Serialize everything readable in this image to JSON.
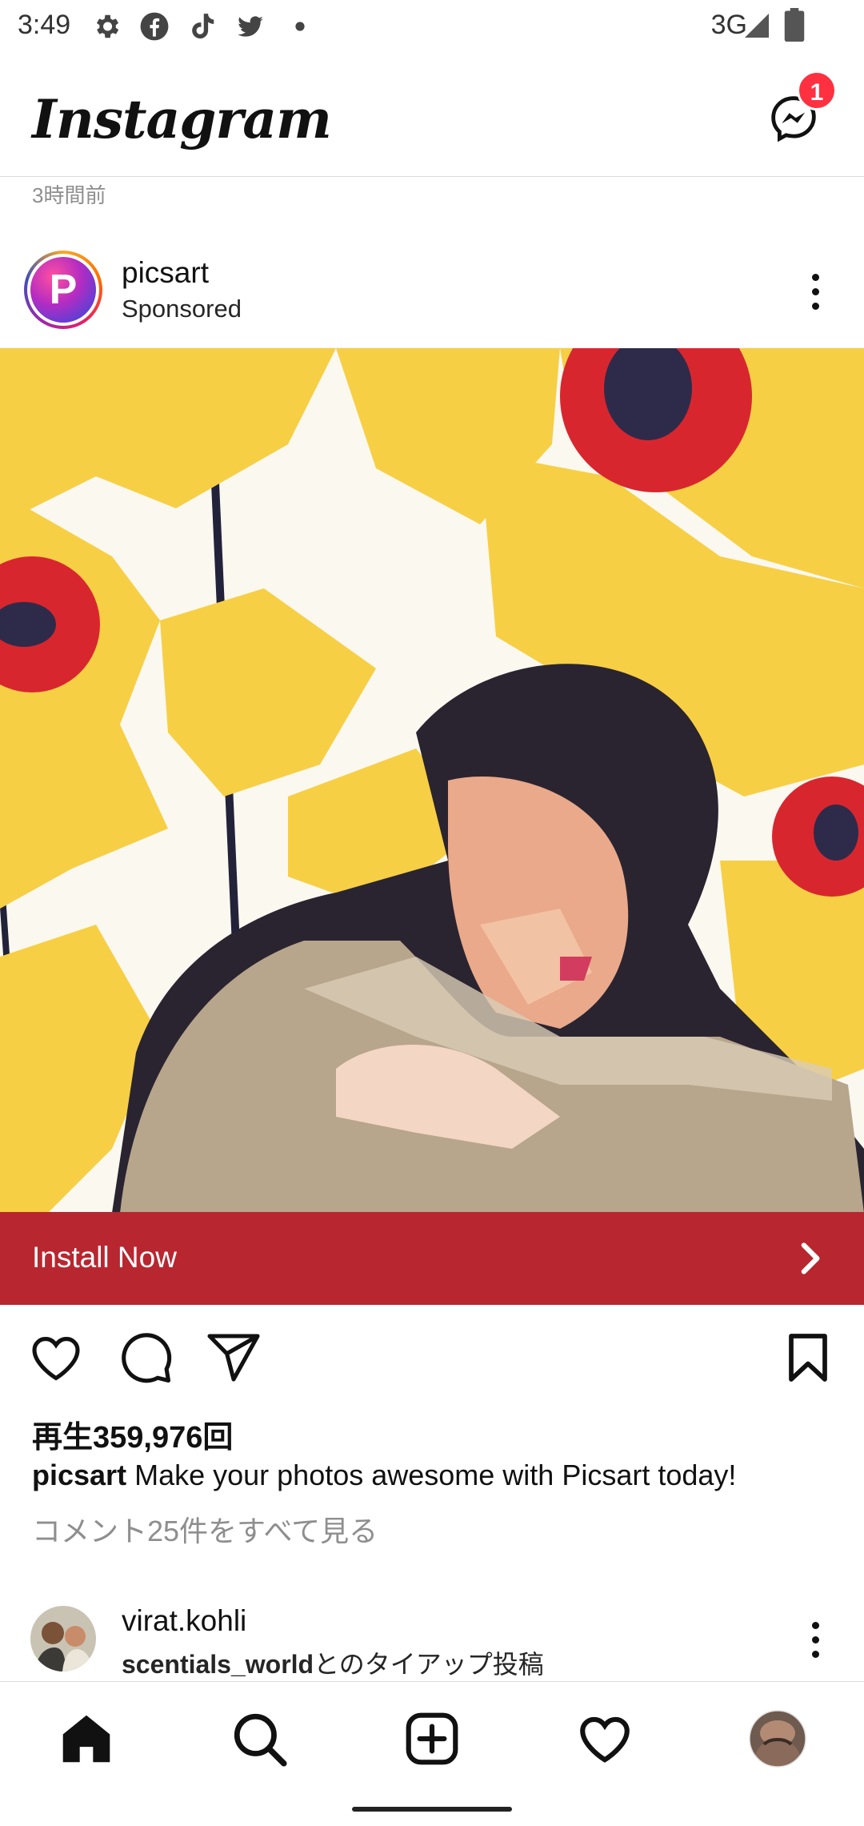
{
  "status_bar": {
    "time": "3:49",
    "network": "3G",
    "notification_icons": [
      "gear-icon",
      "facebook-icon",
      "tiktok-icon",
      "twitter-icon",
      "dot-icon"
    ],
    "system_icons": [
      "signal-icon",
      "battery-icon"
    ]
  },
  "header": {
    "logo_text": "Instagram",
    "messenger_badge": "1"
  },
  "feed": {
    "previous_post_timestamp": "3時間前",
    "post": {
      "username": "picsart",
      "sponsored_label": "Sponsored",
      "avatar_letter": "P",
      "cta_label": "Install Now",
      "views": "再生359,976回",
      "caption_user": "picsart",
      "caption_text": "Make your photos awesome with Picsart today!",
      "view_comments": "コメント25件をすべて見る"
    },
    "next_post": {
      "username": "virat.kohli",
      "partner": "scentials_world",
      "partner_suffix": "とのタイアップ投稿"
    }
  },
  "bottom_nav": {
    "items": [
      "home-icon",
      "search-icon",
      "create-icon",
      "activity-heart-icon",
      "profile-avatar"
    ]
  },
  "colors": {
    "cta_background": "#b8262f",
    "badge": "#ff3040",
    "flower_yellow": "#f7cf44",
    "flower_red": "#d8262f"
  }
}
